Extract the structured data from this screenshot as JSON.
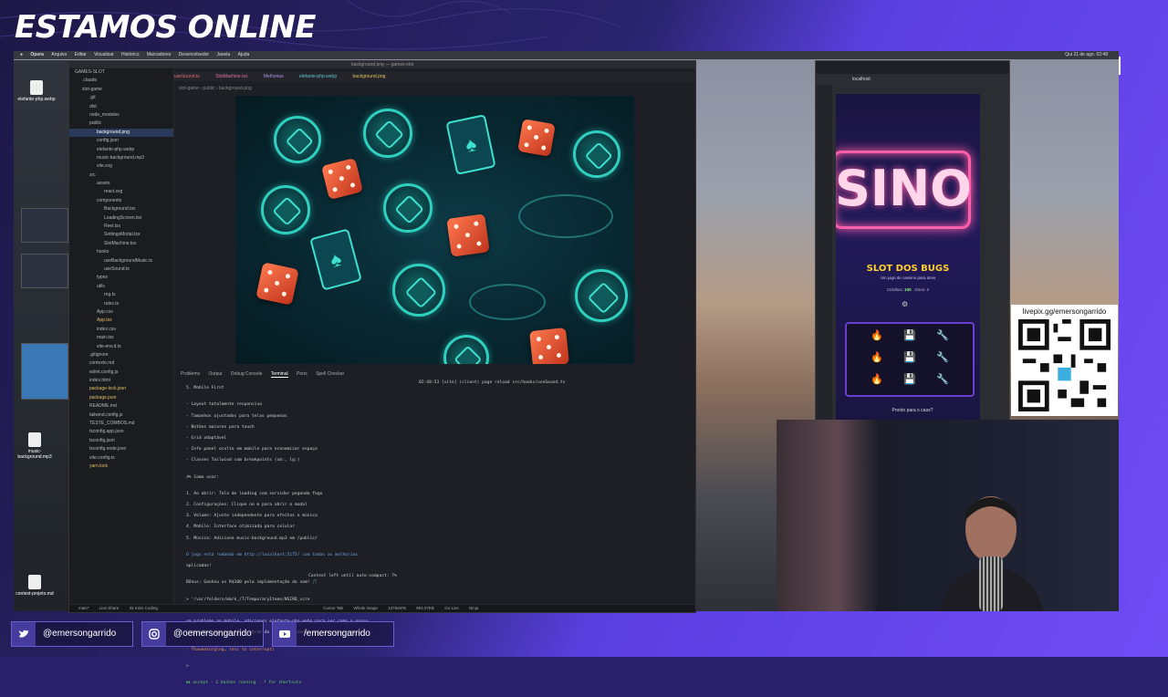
{
  "stream": {
    "title": "ESTAMOS ONLINE",
    "social": [
      {
        "platform": "twitter-icon",
        "handle": "@emersongarrido"
      },
      {
        "platform": "instagram-icon",
        "handle": "@oemersongarrido"
      },
      {
        "platform": "youtube-icon",
        "handle": "/emersongarrido"
      }
    ],
    "qr_label": "livepix.gg/emersongarrido"
  },
  "menubar": {
    "items": [
      "Opera",
      "Arquivo",
      "Editar",
      "Visualizar",
      "Histórico",
      "Marcadores",
      "Desenvolvedor",
      "Janela",
      "Ajuda"
    ],
    "clock": "Qui 21 de ago. 02:48"
  },
  "desktop": {
    "icons": [
      "elefante-php.webp",
      "music-background.mp3",
      "context-projeto.md"
    ]
  },
  "vscode": {
    "window_title": "background.png — games-slot",
    "tabs": [
      "useSound.ts",
      "SlotMachine.tsx",
      "Melhorias",
      "elefante-php.webp",
      "background.png"
    ],
    "breadcrumb": "slot-game › public › background.png",
    "tree": [
      "GAMES-SLOT",
      ".claude",
      "slot-game",
      ".git",
      "dist",
      "node_modules",
      "public",
      "background.png",
      "config.json",
      "elefante-php.webp",
      "music-background.mp3",
      "vite.svg",
      "src",
      "assets",
      "react.svg",
      "components",
      "Background.tsx",
      "LoadingScreen.tsx",
      "Reel.tsx",
      "SettingsModal.tsx",
      "SlotMachine.tsx",
      "hooks",
      "useBackgroundMusic.ts",
      "useSound.ts",
      "types",
      "utils",
      "rng.ts",
      "rules.ts",
      "App.css",
      "App.tsx",
      "index.css",
      "main.tsx",
      "vite-env.d.ts",
      ".gitignore",
      "contexto.md",
      "eslint.config.js",
      "index.html",
      "package-lock.json",
      "package.json",
      "README.md",
      "tailwind.config.js",
      "TESTE_COMBOS.md",
      "tsconfig.app.json",
      "tsconfig.json",
      "tsconfig.node.json",
      "vite.config.ts",
      "yarn.lock"
    ],
    "active_file": "background.png",
    "panel_tabs": [
      "Problems",
      "Output",
      "Debug Console",
      "Terminal",
      "Ports",
      "Spell Checker"
    ],
    "active_panel": "Terminal",
    "terminal_lines": [
      "5. Mobile First",
      "",
      "- Layout totalmente responsivo",
      "- Tamanhos ajustados para telas pequenas",
      "- Botões maiores para touch",
      "- Grid adaptável",
      "- Info panel oculto em mobile para economizar espaço",
      "- Classes Tailwind com breakpoints (sm:, lg:)",
      "",
      "🎮 Como usar:",
      "",
      "1. Ao abrir: Tela de loading com servidor pegando fogo",
      "2. Configurações: Clique no ⚙ para abrir o modal",
      "3. Volume: Ajuste independente para efeitos e música",
      "4. Mobile: Interface otimizada para celular",
      "5. Música: Adicione music-background.mp3 em /public/",
      "",
      "O jogo está rodando em http://localhost:5175/ com todas as melhorias",
      "aplicadas!",
      "",
      "Bônus: Ganhou os R$100 pela implementação do som! 🎵",
      "",
      "> '/var/folders/mm/k_/T/TemporaryItems/NSIRD_scre",
      "encaptureui_plaUBp/Captura de Tela 2025-08-21 às 02.44.37.png' ainda temos",
      "um problema no mobile, adicionei elefante-php.webp para ser como o nosso",
      "\"tigrinho\" que vai ficar atras do game se movendo pra cima e pra baixo.",
      "",
      "· Thaumaturging… (esc to interrupt)",
      "",
      ">",
      "",
      "⏵⏵ accept · 2 bashes running · ? for shortcuts"
    ],
    "terminal_right": "02:48:53 [vite] (client) page reload src/hooks/useSound.ts",
    "context_note": "Context left until auto-compact: 7%",
    "status": [
      "main*",
      "Live Share",
      "32 mins Coding",
      "Cursor Tab",
      "Whole Image",
      "1376x876",
      "904.07KB",
      "Go Live",
      "Ninja"
    ]
  },
  "browser": {
    "url": "localhost",
    "game": {
      "neon_title": "SINO",
      "title": "SLOT DOS BUGS",
      "subtitle": "Um jogo de cassino para devs",
      "credits_label": "Créditos:",
      "credits": "100",
      "spins_label": "Giros:",
      "spins": "0",
      "footer": "Pronto para o caos?"
    }
  },
  "colors": {
    "accent": "#6f4cf5",
    "neon_pink": "#ff5ea8",
    "slot_gold": "#ffd02e"
  }
}
